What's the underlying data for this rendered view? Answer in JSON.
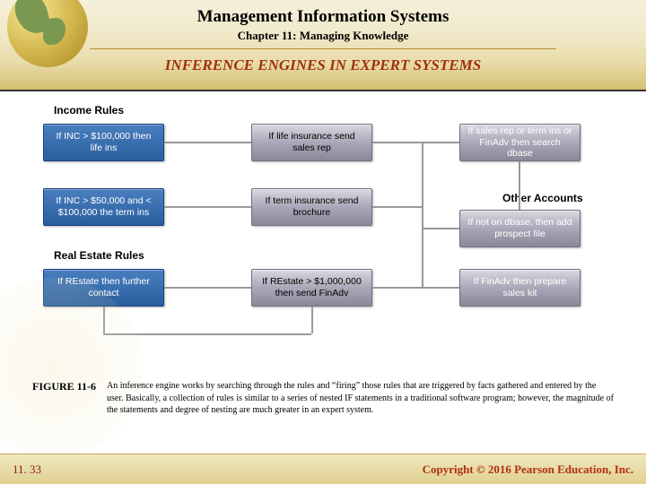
{
  "header": {
    "title": "Management Information Systems",
    "subtitle": "Chapter 11: Managing Knowledge",
    "section": "INFERENCE ENGINES IN EXPERT SYSTEMS"
  },
  "diagram": {
    "labels": {
      "income": "Income Rules",
      "realestate": "Real Estate Rules",
      "other": "Other Accounts"
    },
    "boxes": {
      "b1": "If INC > $100,000\nthen life ins",
      "b2": "If life insurance\nsend sales rep",
      "b3": "If sales rep or term ins\nor FinAdv\nthen search dbase",
      "b4": "If INC > $50,000 and\n< $100,000 the term ins",
      "b5": "If term insurance\nsend brochure",
      "b6": "If not on dbase,\nthen add prospect file",
      "b7": "If REstate\nthen further\ncontact",
      "b8": "If REstate > $1,000,000\nthen send FinAdv",
      "b9": "If FinAdv\nthen prepare sales kit"
    }
  },
  "caption": {
    "label": "FIGURE 11-6",
    "text": "An inference engine works by searching through the rules and “firing” those rules that are triggered by facts gathered and entered by the user. Basically, a collection of rules is similar to a series of nested IF statements in a traditional software program; however, the magnitude of the statements and degree of nesting are much greater in an expert system."
  },
  "footer": {
    "slide": "11. 33",
    "copyright": "Copyright © 2016 Pearson Education, Inc."
  }
}
